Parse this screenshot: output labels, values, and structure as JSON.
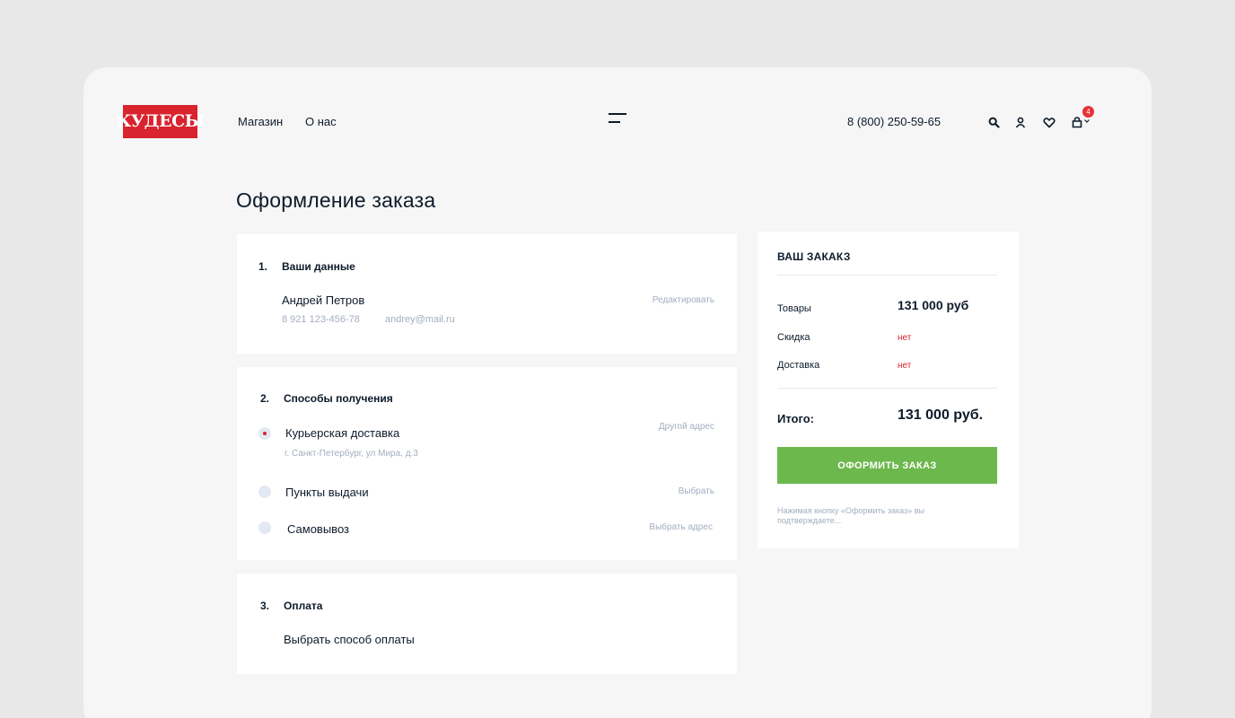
{
  "header": {
    "logo_text": "КУДЕСЫ",
    "nav": [
      {
        "label": "Магазин"
      },
      {
        "label": "О нас"
      }
    ],
    "phone": "8 (800) 250-59-65",
    "cart_count": "4",
    "icons": [
      "search-icon",
      "user-icon",
      "heart-icon",
      "bag-icon",
      "chevron-down-icon",
      "menu-icon"
    ]
  },
  "page": {
    "title": "Оформление заказа"
  },
  "sections": {
    "personal": {
      "number": "1.",
      "title": "Ваши данные",
      "name": "Андрей Петров",
      "phone": "8 921 123-456-78",
      "email": "andrey@mail.ru",
      "edit_label": "Редактировать"
    },
    "delivery": {
      "number": "2.",
      "title": "Способы получения",
      "options": [
        {
          "label": "Курьерская доставка",
          "sublabel": "г. Санкт-Петербург, ул Мира, д.3",
          "action": "Другой адрес",
          "selected": true
        },
        {
          "label": "Пункты выдачи",
          "action": "Выбрать",
          "selected": false
        },
        {
          "label": "Самовывоз",
          "action": "Выбрать адрес",
          "selected": false
        }
      ]
    },
    "payment": {
      "number": "3.",
      "title": "Оплата",
      "choose_label": "Выбрать способ оплаты"
    }
  },
  "summary": {
    "title": "ВАШ ЗАКАКЗ",
    "goods_label": "Товары",
    "goods_value": "131 000 руб",
    "discount_label": "Скидка",
    "discount_value": "нет",
    "delivery_label": "Доставка",
    "delivery_value": "нет",
    "total_label": "Итого:",
    "total_value": "131 000 руб.",
    "button_label": "ОФОРМИТЬ ЗАКАЗ",
    "note": "Нажимая кнопку «Оформить заказ» вы подтверждаете..."
  },
  "colors": {
    "brand_red": "#d9232e",
    "button_green": "#6db84d",
    "muted_text": "#a3aec0",
    "text": "#0d1b2a"
  }
}
